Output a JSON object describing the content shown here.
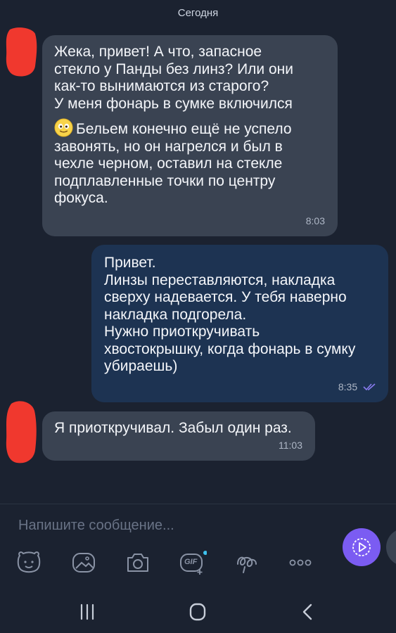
{
  "conversation": {
    "date_label": "Сегодня"
  },
  "messages": [
    {
      "direction": "incoming",
      "paragraph_1": "Жека, привет! А что, запасное\nстекло у Панды без линз? Или они\nкак-то вынимаются из старого?\nУ меня фонарь в сумке включился",
      "emoji": "smiling-face-emoji",
      "paragraph_2": "Бельем конечно ещё не успело\nзавонять, но он нагрелся и был в\nчехле черном, оставил на стекле\nподплавленные точки по центру\nфокуса.",
      "time": "8:03"
    },
    {
      "direction": "outgoing",
      "text": "Привет.\nЛинзы переставляются, накладка\nсверху надевается. У тебя наверно\nнакладка подгорела.\nНужно приоткручивать\nхвостокрышку, когда фонарь в сумку\nубираешь)",
      "time": "8:35",
      "status_icon": "double-check-icon"
    },
    {
      "direction": "incoming",
      "text": "Я приоткручивал. Забыл один раз.",
      "time": "11:03"
    }
  ],
  "composer": {
    "placeholder": "Напишите сообщение...",
    "tools": [
      "sticker-icon",
      "gallery-icon",
      "camera-icon",
      "gif-icon",
      "doodle-icon",
      "more-icon"
    ],
    "gif_label": "GIF",
    "send_icon": "video-message-icon"
  },
  "nav": {
    "buttons": [
      "recent-apps-icon",
      "home-icon",
      "back-icon"
    ]
  },
  "colors": {
    "background": "#1b2230",
    "incoming_bubble": "#3a4352",
    "outgoing_bubble": "#1d3352",
    "accent": "#7b5cf2",
    "redaction": "#f0382e"
  }
}
